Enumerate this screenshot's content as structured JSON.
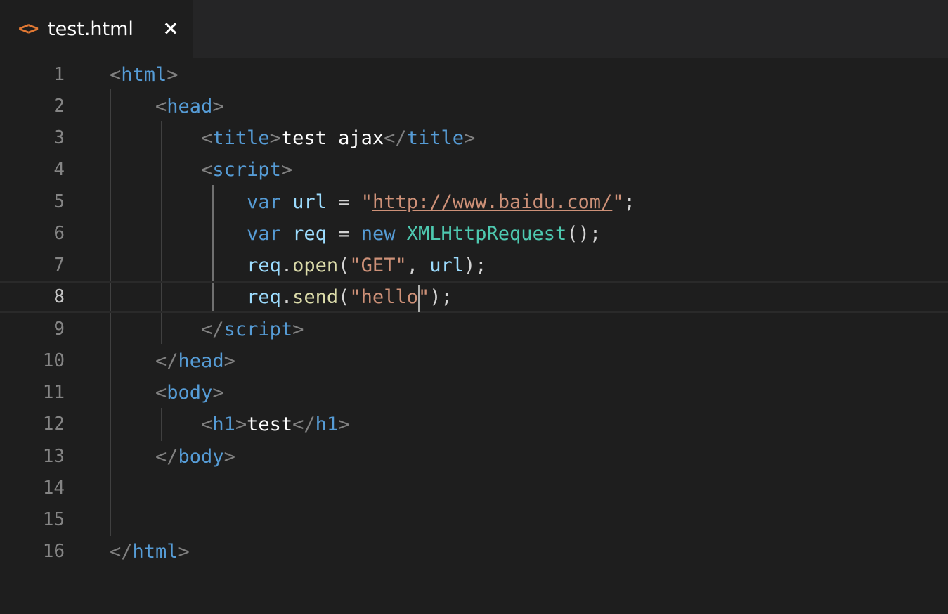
{
  "tab": {
    "icon": "<>",
    "icon_name": "html-file-icon",
    "label": "test.html",
    "close": "×"
  },
  "editor": {
    "current_line": 8,
    "line_numbers": [
      "1",
      "2",
      "3",
      "4",
      "5",
      "6",
      "7",
      "8",
      "9",
      "10",
      "11",
      "12",
      "13",
      "14",
      "15",
      "16"
    ],
    "lines": {
      "l1": {
        "br_open": "<",
        "tag": "html",
        "br_close": ">"
      },
      "l2": {
        "br_open": "<",
        "tag": "head",
        "br_close": ">"
      },
      "l3": {
        "br_open": "<",
        "tag": "title",
        "br_close": ">",
        "text": "test ajax",
        "br_end_open": "</",
        "tag_end": "title",
        "br_end_close": ">"
      },
      "l4": {
        "br_open": "<",
        "tag": "script",
        "br_close": ">"
      },
      "l5": {
        "kw": "var",
        "name": "url",
        "op": " = ",
        "q1": "\"",
        "link": "http://www.baidu.com/",
        "q2": "\"",
        "end": ";"
      },
      "l6": {
        "kw": "var",
        "name": "req",
        "op": " = ",
        "kw2": "new",
        "cls": "XMLHttpRequest",
        "end": "();"
      },
      "l7": {
        "obj": "req",
        "dot": ".",
        "fn": "open",
        "p1": "(",
        "str": "\"GET\"",
        "comma": ", ",
        "arg": "url",
        "end": ");"
      },
      "l8": {
        "obj": "req",
        "dot": ".",
        "fn": "send",
        "p1": "(",
        "str_a": "\"hello",
        "str_b": "\"",
        "end": ");"
      },
      "l9": {
        "br_open": "</",
        "tag": "script",
        "br_close": ">"
      },
      "l10": {
        "br_open": "</",
        "tag": "head",
        "br_close": ">"
      },
      "l11": {
        "br_open": "<",
        "tag": "body",
        "br_close": ">"
      },
      "l12": {
        "br_open": "<",
        "tag": "h1",
        "br_close": ">",
        "text": "test",
        "br_end_open": "</",
        "tag_end": "h1",
        "br_end_close": ">"
      },
      "l13": {
        "br_open": "</",
        "tag": "body",
        "br_close": ">"
      },
      "l16": {
        "br_open": "</",
        "tag": "html",
        "br_close": ">"
      }
    }
  },
  "colors": {
    "background": "#1e1e1e",
    "tab_bar": "#252526",
    "tag": "#569cd6",
    "bracket": "#808080",
    "string": "#ce9178",
    "variable": "#9cdcfe",
    "class": "#4ec9b0",
    "function": "#dcdcaa",
    "file_icon": "#e37933"
  }
}
